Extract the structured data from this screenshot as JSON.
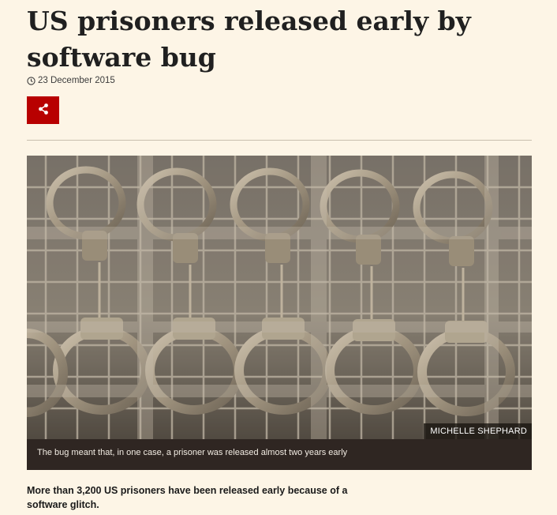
{
  "article": {
    "headline": "US prisoners released early by software bug",
    "date": "23 December 2015",
    "share_icon": "share-icon",
    "clock_icon": "clock-icon",
    "image": {
      "credit": "MICHELLE SHEPHARD",
      "caption": "The bug meant that, in one case, a prisoner was released almost two years early"
    },
    "lede": "More than 3,200 US prisoners have been released early because of a software glitch."
  },
  "colors": {
    "background": "#fdf5e6",
    "share_button": "#b80000",
    "caption_bg": "#2f2622"
  }
}
